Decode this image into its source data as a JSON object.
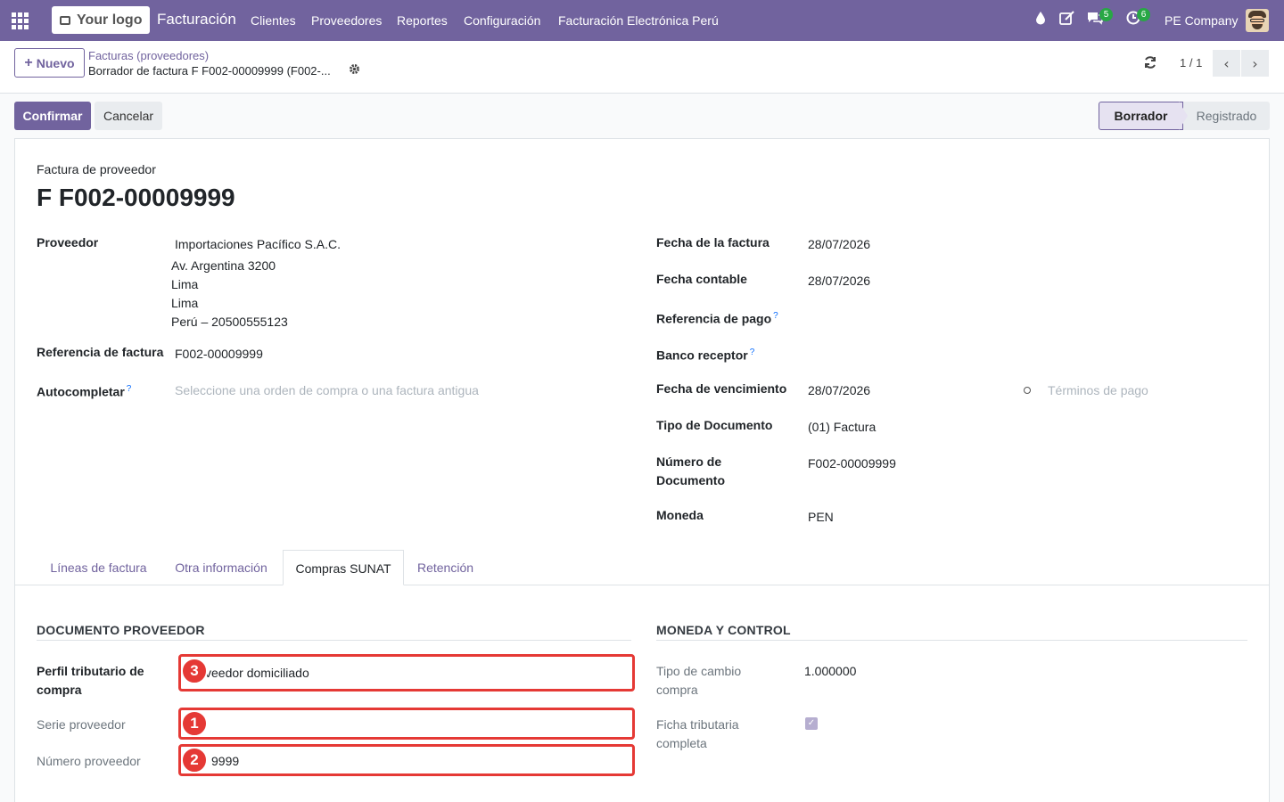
{
  "topnav": {
    "logo_text": "Your logo",
    "app_name": "Facturación",
    "menu": [
      "Clientes",
      "Proveedores",
      "Reportes",
      "Configuración",
      "Facturación Electrónica Perú"
    ],
    "messages_badge": "5",
    "activities_badge": "6",
    "company": "PE Company"
  },
  "control": {
    "new_label": "Nuevo",
    "breadcrumb_parent": "Facturas (proveedores)",
    "breadcrumb_current": "Borrador de factura F F002-00009999 (F002-...",
    "pager": "1 / 1"
  },
  "statusbar": {
    "confirm_label": "Confirmar",
    "cancel_label": "Cancelar",
    "stages": [
      "Borrador",
      "Registrado"
    ]
  },
  "form": {
    "subtitle": "Factura de proveedor",
    "title": "F F002-00009999",
    "left": {
      "proveedor_label": "Proveedor",
      "proveedor_name": "Importaciones Pacífico S.A.C.",
      "address": [
        "Av. Argentina 3200",
        "Lima",
        "Lima",
        "Perú – 20500555123"
      ],
      "ref_label": "Referencia de factura",
      "ref_value": "F002-00009999",
      "autocomplete_label": "Autocompletar",
      "autocomplete_placeholder": "Seleccione una orden de compra o una factura antigua"
    },
    "right": {
      "fecha_factura_label": "Fecha de la factura",
      "fecha_factura": "28/07/2026",
      "fecha_contable_label": "Fecha contable",
      "fecha_contable": "28/07/2026",
      "ref_pago_label": "Referencia de pago",
      "banco_label": "Banco receptor",
      "vencimiento_label": "Fecha de vencimiento",
      "vencimiento": "28/07/2026",
      "terminos_placeholder": "Términos de pago",
      "tipo_doc_label": "Tipo de Documento",
      "tipo_doc": "(01) Factura",
      "num_doc_label_1": "Número de",
      "num_doc_label_2": "Documento",
      "num_doc": "F002-00009999",
      "moneda_label": "Moneda",
      "moneda": "PEN"
    }
  },
  "tabs": [
    "Líneas de factura",
    "Otra información",
    "Compras SUNAT",
    "Retención"
  ],
  "sunat": {
    "left_title": "DOCUMENTO PROVEEDOR",
    "perfil_label_1": "Perfil tributario de",
    "perfil_label_2": "compra",
    "perfil_value": "veedor domiciliado",
    "serie_label": "Serie proveedor",
    "serie_value": "",
    "numero_label": "Número proveedor",
    "numero_value": "9999",
    "right_title": "MONEDA Y CONTROL",
    "tc_label_1": "Tipo de cambio",
    "tc_label_2": "compra",
    "tc_value": "1.000000",
    "ficha_label_1": "Ficha tributaria",
    "ficha_label_2": "completa",
    "markers": [
      "3",
      "1",
      "2"
    ]
  }
}
